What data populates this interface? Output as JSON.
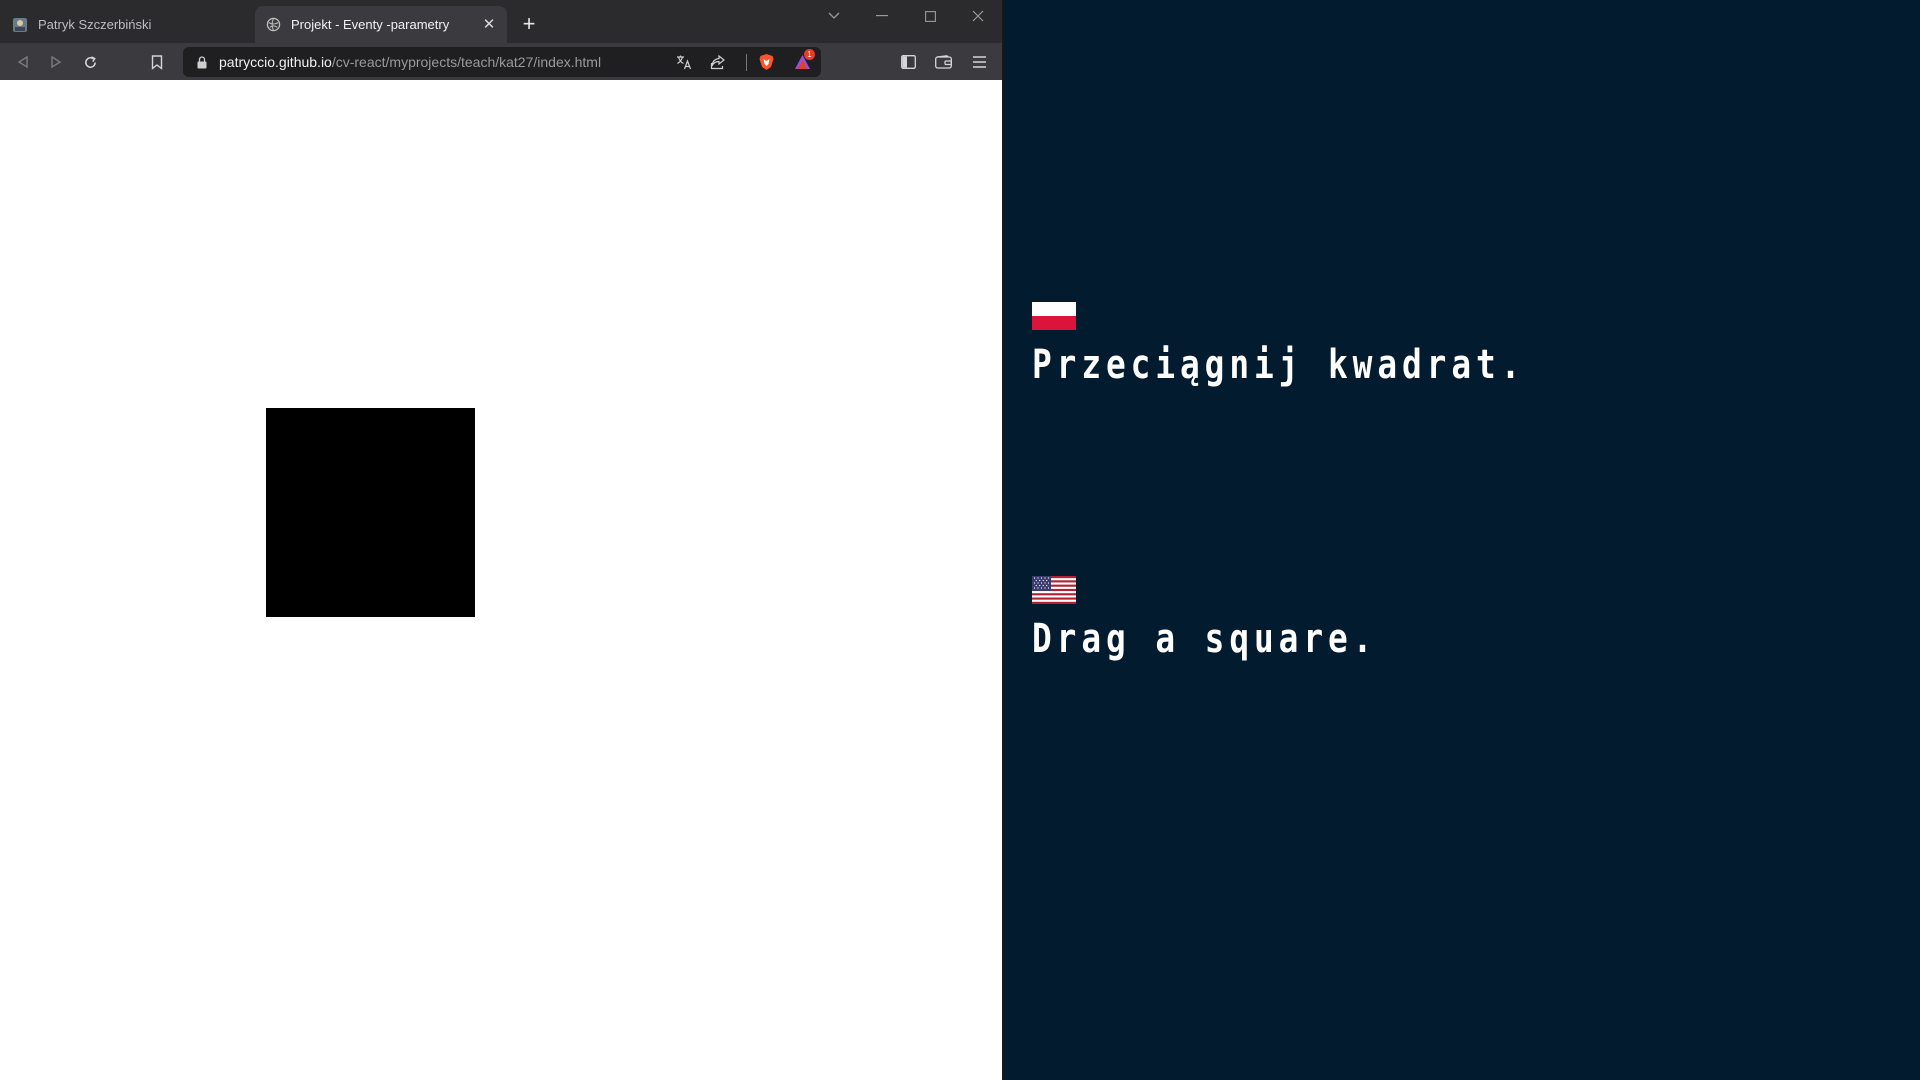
{
  "browser": {
    "tabs": [
      {
        "title": "Patryk Szczerbiński",
        "active": false
      },
      {
        "title": "Projekt - Eventy -parametry",
        "active": true
      }
    ],
    "url": {
      "host": "patryccio.github.io",
      "path": "/cv-react/myprojects/teach/kat27/index.html"
    },
    "notification_count": "1"
  },
  "panel": {
    "polish": {
      "flag": "poland-flag-icon",
      "text": "Przeciągnij kwadrat."
    },
    "english": {
      "flag": "usa-flag-icon",
      "text": "Drag a square."
    }
  },
  "colors": {
    "panel_bg": "#021b2e",
    "square": "#000000",
    "brave_orange": "#fb542b"
  }
}
